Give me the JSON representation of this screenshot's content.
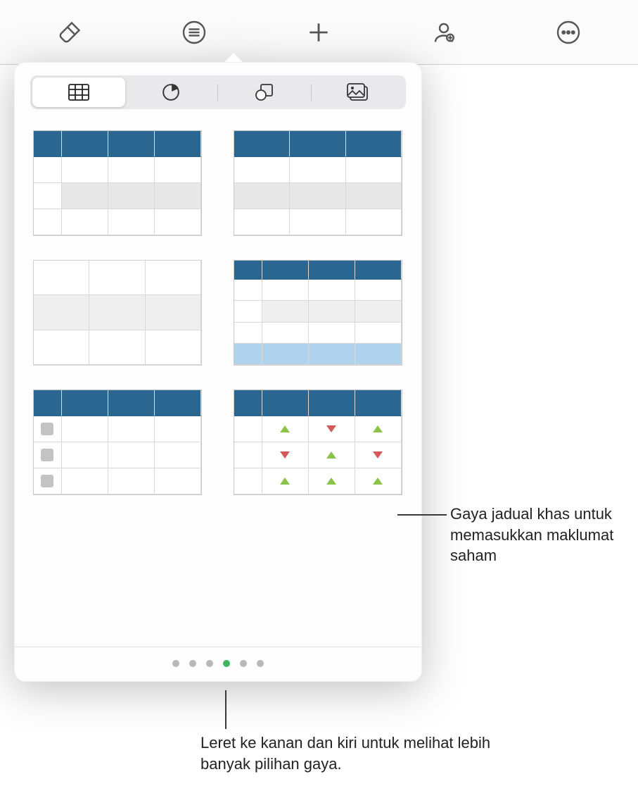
{
  "toolbar": {
    "items": [
      {
        "name": "format-brush-icon"
      },
      {
        "name": "list-icon"
      },
      {
        "name": "add-icon"
      },
      {
        "name": "collaborate-icon"
      },
      {
        "name": "more-icon"
      }
    ]
  },
  "popover": {
    "tabs": [
      {
        "name": "tab-tables",
        "icon": "table-icon",
        "active": true
      },
      {
        "name": "tab-charts",
        "icon": "pie-chart-icon",
        "active": false
      },
      {
        "name": "tab-shapes",
        "icon": "shapes-icon",
        "active": false
      },
      {
        "name": "tab-media",
        "icon": "media-icon",
        "active": false
      }
    ],
    "styles": [
      {
        "name": "table-style-header-firstcol"
      },
      {
        "name": "table-style-header-plain"
      },
      {
        "name": "table-style-plain-grid"
      },
      {
        "name": "table-style-header-accent-row"
      },
      {
        "name": "table-style-checklist"
      },
      {
        "name": "table-style-stock"
      }
    ],
    "stock_arrows": [
      [
        "up",
        "down",
        "up"
      ],
      [
        "down",
        "up",
        "down"
      ],
      [
        "up",
        "up",
        "up"
      ]
    ],
    "pagination": {
      "total": 6,
      "active_index": 3
    }
  },
  "callouts": {
    "right": "Gaya jadual khas untuk memasukkan maklumat saham",
    "bottom": "Leret ke kanan dan kiri untuk melihat lebih banyak pilihan gaya."
  },
  "colors": {
    "header_blue": "#2b6690",
    "accent_blue": "#afd3ed",
    "arrow_up": "#8bc34a",
    "arrow_down": "#d45a5a",
    "dot_active": "#3cb55c"
  }
}
